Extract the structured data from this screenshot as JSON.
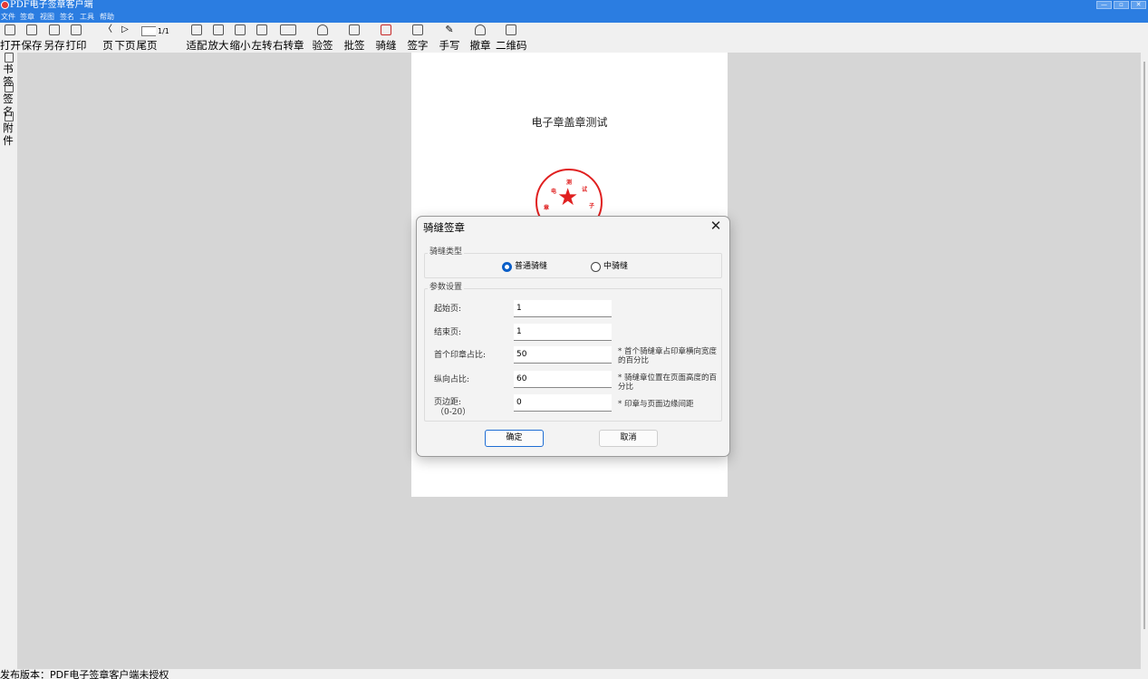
{
  "window": {
    "title": "PDF电子签章客户端",
    "controls": [
      "minimize",
      "maximize",
      "close"
    ]
  },
  "menu": [
    "文件",
    "签章",
    "视图",
    "签名",
    "工具",
    "帮助"
  ],
  "toolbar": {
    "open": "打开",
    "save": "保存",
    "save_as": "另存",
    "print": "打印",
    "prev_page": "页",
    "next_page": "下页",
    "last_page": "尾页",
    "page_input": "",
    "page_count": "1/1",
    "fit": "适配",
    "zoom_in": "放大",
    "zoom_out": "缩小",
    "rotate_left": "左转",
    "rotate_right": "右转",
    "right_stamp_suffix": "章",
    "verify": "验签",
    "batch_sign": "批签",
    "seam_stamp": "骑缝",
    "sign_text": "签字",
    "handwrite": "手写",
    "revoke": "撤章",
    "qrcode": "二维码"
  },
  "sidebar": {
    "bookmarks": "书签",
    "signatures": "签名",
    "attachments": "附件"
  },
  "document": {
    "title": "电子章盖章测试",
    "seal_text": [
      "章",
      "电",
      "测",
      "试",
      "子"
    ],
    "seal_color": "#e02020"
  },
  "dialog": {
    "title": "骑缝签章",
    "type_group": "骑缝类型",
    "type_options": [
      {
        "label": "普通骑缝",
        "checked": true
      },
      {
        "label": "中骑缝",
        "checked": false
      }
    ],
    "params_group": "参数设置",
    "fields": [
      {
        "label": "起始页:",
        "value": "1",
        "hint": ""
      },
      {
        "label": "结束页:",
        "value": "1",
        "hint": ""
      },
      {
        "label": "首个印章占比:",
        "value": "50",
        "hint": "* 首个骑缝章占印章横向宽度的百分比"
      },
      {
        "label": "纵向占比:",
        "value": "60",
        "hint": "* 骑缝章位置在页面高度的百分比"
      },
      {
        "label": "页边距:",
        "label2": "（0-20）",
        "value": "0",
        "hint": "* 印章与页面边缘间距"
      }
    ],
    "ok": "确定",
    "cancel": "取消"
  },
  "status": {
    "text": "发布版本：PDF电子签章客户端未授权"
  },
  "colors": {
    "titlebar": "#2b7de1",
    "accent": "#0a5fc8",
    "viewport": "#d6d6d6"
  }
}
